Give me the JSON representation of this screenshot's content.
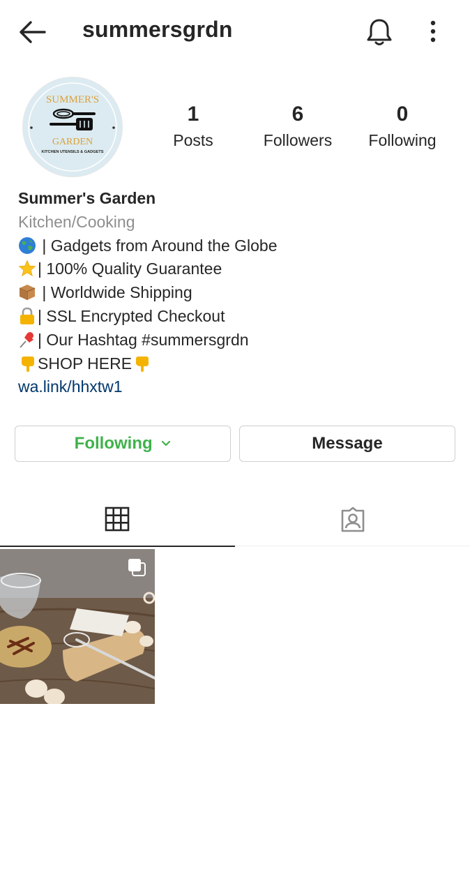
{
  "header": {
    "username": "summersgrdn",
    "back_icon": "arrow-left-icon",
    "bell_icon": "bell-icon",
    "more_icon": "more-vertical-icon"
  },
  "profile": {
    "avatar": {
      "line1": "SUMMER'S",
      "line2": "GARDEN",
      "line3": "KITCHEN UTENSILS & GADGETS"
    },
    "stats": [
      {
        "count": "1",
        "label": "Posts"
      },
      {
        "count": "6",
        "label": "Followers"
      },
      {
        "count": "0",
        "label": "Following"
      }
    ]
  },
  "bio": {
    "name": "Summer's Garden",
    "category": "Kitchen/Cooking",
    "lines": [
      {
        "emoji": "globe-icon",
        "text": " | Gadgets from Around the Globe"
      },
      {
        "emoji": "star-icon",
        "text": "| 100% Quality Guarantee"
      },
      {
        "emoji": "package-icon",
        "text": " | Worldwide Shipping"
      },
      {
        "emoji": "lock-icon",
        "text": "| SSL Encrypted Checkout"
      },
      {
        "emoji": "pushpin-icon",
        "text": "| Our Hashtag #summersgrdn"
      }
    ],
    "shop_text": "SHOP HERE",
    "link": "wa.link/hhxtw1"
  },
  "actions": {
    "following_label": "Following",
    "message_label": "Message"
  },
  "colors": {
    "following_green": "#3fb24b",
    "link_blue": "#00376b",
    "muted": "#8e8e8e"
  },
  "tabs": [
    {
      "icon": "grid-icon",
      "active": true
    },
    {
      "icon": "tagged-icon",
      "active": false
    }
  ],
  "posts": [
    {
      "icon": "multiple-posts-icon"
    }
  ]
}
